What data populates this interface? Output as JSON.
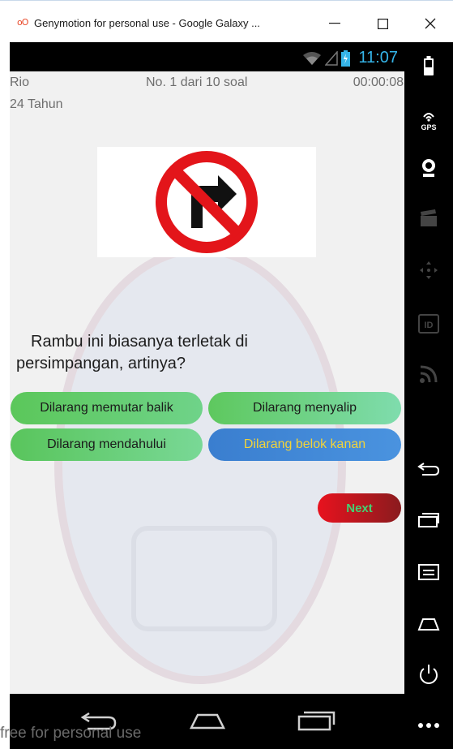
{
  "window": {
    "title": "Genymotion for personal use - Google Galaxy ...",
    "app_icon": "genymotion-logo",
    "minimize_label": "—",
    "maximize_label": "☐",
    "close_label": "✕"
  },
  "status_bar": {
    "time": "11:07",
    "icons": [
      "wifi-icon",
      "signal-icon",
      "battery-icon"
    ],
    "accent_color": "#35b4e8"
  },
  "header": {
    "name": "Rio",
    "age": "24 Tahun",
    "question_counter": "No. 1 dari 10 soal",
    "timer": "00:00:08"
  },
  "question": {
    "sign_image": "no-right-turn-sign",
    "line1": "Rambu  ini biasanya terletak di",
    "line2": "persimpangan, artinya?"
  },
  "answers": [
    {
      "label": "Dilarang memutar balik",
      "color": "#5bc75a"
    },
    {
      "label": "Dilarang menyalip",
      "color": "#5ec85e"
    },
    {
      "label": "Dilarang mendahului",
      "color": "#59c55c"
    },
    {
      "label": "Dilarang belok kanan",
      "color": "#3a7ecf",
      "selected": true
    }
  ],
  "next_button": {
    "label": "Next",
    "color": "#e8121e"
  },
  "nav_bar": {
    "icons": [
      "back-icon",
      "home-icon",
      "recent-apps-icon"
    ]
  },
  "watermark_text": "free for personal use",
  "sidebar": {
    "icons": [
      "battery-icon",
      "gps-icon",
      "webcam-icon",
      "clapper-icon",
      "dpad-icon",
      "id-icon",
      "rss-icon",
      "back-icon",
      "recent-apps-icon",
      "menu-icon",
      "home-icon",
      "power-icon",
      "more-icon"
    ],
    "gps_label": "GPS",
    "id_label": "ID"
  }
}
